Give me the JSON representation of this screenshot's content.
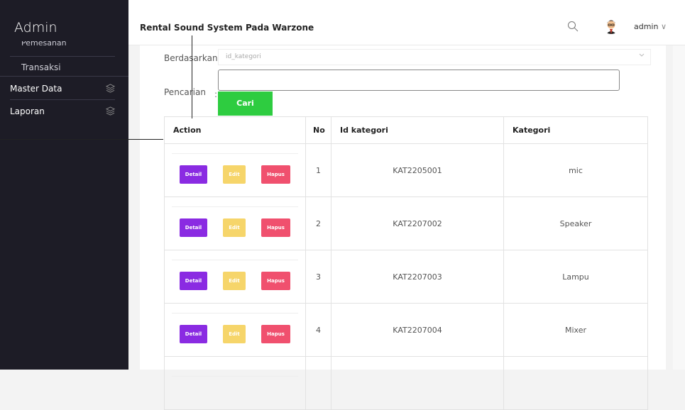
{
  "sidebar": {
    "brand": "Admin",
    "cut_item": "Pemesanan",
    "items": [
      {
        "label": "Transaksi"
      },
      {
        "label": "Master Data",
        "icon": "layers-icon"
      },
      {
        "label": "Laporan",
        "icon": "layers-icon"
      }
    ]
  },
  "header": {
    "title": "Rental Sound System Pada Warzone",
    "user": "admin",
    "user_caret": "∨"
  },
  "filter": {
    "by_label": "Berdasarkan:",
    "by_value": "id_kategori",
    "search_label": "Pencarian",
    "search_colon": ":",
    "search_value": "",
    "search_button": "Cari"
  },
  "table": {
    "headers": [
      "Action",
      "No",
      "Id kategori",
      "Kategori"
    ],
    "buttons": {
      "detail": "Detail",
      "edit": "Edit",
      "hapus": "Hapus"
    },
    "rows": [
      {
        "no": "1",
        "id": "KAT2205001",
        "kategori": "mic"
      },
      {
        "no": "2",
        "id": "KAT2207002",
        "kategori": "Speaker"
      },
      {
        "no": "3",
        "id": "KAT2207003",
        "kategori": "Lampu"
      },
      {
        "no": "4",
        "id": "KAT2207004",
        "kategori": "Mixer"
      }
    ]
  }
}
